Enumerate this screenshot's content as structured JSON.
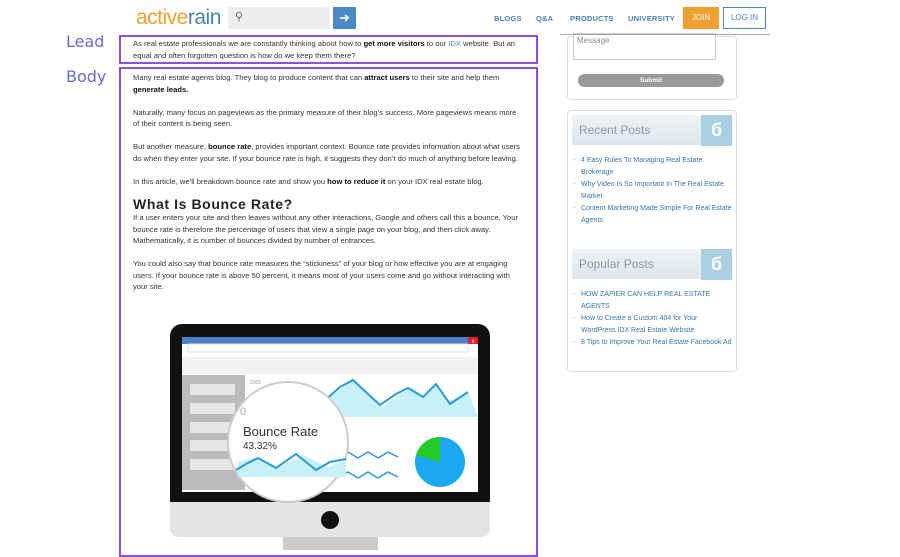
{
  "header": {
    "logo_part1": "active",
    "logo_part2": "rain",
    "search_placeholder": "",
    "nav": [
      "BLOGS",
      "Q&A",
      "PRODUCTS",
      "UNIVERSITY"
    ],
    "join": "JOIN",
    "login": "LOG IN"
  },
  "annotations": {
    "lead": "Lead",
    "body": "Body"
  },
  "lead": {
    "t1": "As real estate professionals we are constantly thinking about how to ",
    "b1": "get more visitors",
    "t2": " to our ",
    "link": "IDX",
    "t3": " website. But an equal and often forgotten question is how do we keep them there?"
  },
  "body": {
    "p1a": "Many real estate agents blog. They blog to produce content that can ",
    "p1b": "attract users",
    "p1c": " to their site and help them ",
    "p1d": "generate leads.",
    "p2": "Naturally, many focus on pageviews as the primary measure of their blog’s success. More pageviews means more of their content is being seen.",
    "p3a": "But another measure, ",
    "p3b": "bounce rate",
    "p3c": ", provides important context. Bounce rate provides information about what users do when they enter your site. If your bounce rate is high, it suggests they don’t do much of anything before leaving.",
    "p4a": "In this article, we’ll breakdown bounce rate and show you ",
    "p4b": "how to reduce it",
    "p4c": " on your IDX real estate blog.",
    "h2": "What Is Bounce Rate?",
    "p5": "If a user enters your site and then leaves without any other interactions, Google and others call this a bounce. Your bounce rate is therefore the percentage of users that view a single page on your blog, and then click away. Mathematically, it is number of bounces divided by number of entrances.",
    "p6": "You could also say that bounce rate measures the “stickiness” of your blog or how effective you are at engaging users. If your bounce rate is above 50 percent, it means most of your users come and go without interacting with your site."
  },
  "illustration": {
    "axis_top": "2000",
    "axis_zero": "0",
    "label": "Bounce Rate",
    "value": "43.32%",
    "close": "x"
  },
  "sidebar": {
    "message_placeholder": "Message",
    "submit": "Submit",
    "recent_title": "Recent Posts",
    "recent": [
      "4 Easy Rules To Managing Real Estate Brokerage",
      "Why Video Is So Important In The Real Estate Market",
      "Content Marketing Made Simple For Real Estate Agents"
    ],
    "popular_title": "Popular Posts",
    "popular": [
      "HOW ZAPIER CAN HELP REAL ESTATE AGENTS",
      "How to Create a Custom 404 for Your WordPress IDX Real Estate Website",
      "8 Tips to Improve Your Real Estate Facebook Ad"
    ]
  }
}
